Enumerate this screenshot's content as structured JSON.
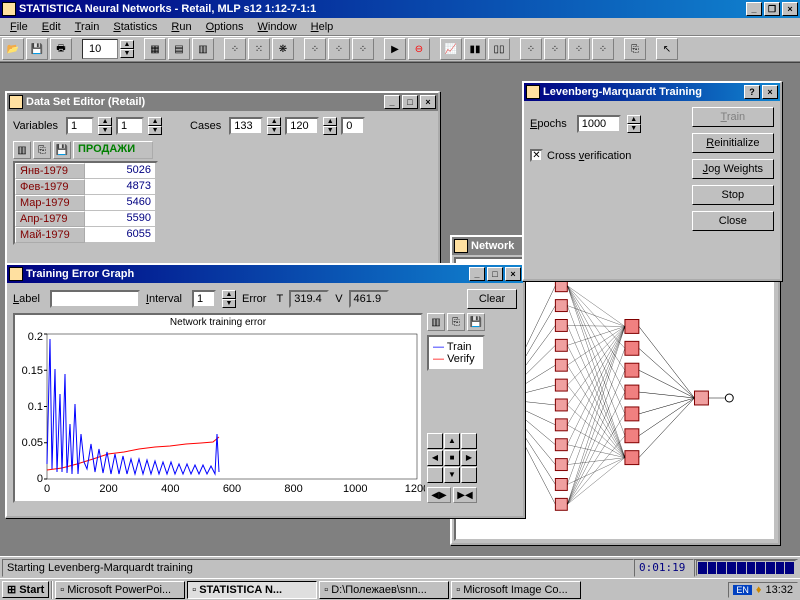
{
  "app": {
    "title": "STATISTICA Neural Networks - Retail, MLP s12 1:12-7-1:1",
    "menus": [
      "File",
      "Edit",
      "Train",
      "Statistics",
      "Run",
      "Options",
      "Window",
      "Help"
    ],
    "spinner_value": "10"
  },
  "dataset_editor": {
    "title": "Data Set Editor (Retail)",
    "variables_label": "Variables",
    "var1": "1",
    "var2": "1",
    "cases_label": "Cases",
    "cases1": "133",
    "cases2": "120",
    "cases3": "0",
    "col_header": "ПРОДАЖИ",
    "rows": [
      {
        "h": "Янв-1979",
        "v": "5026"
      },
      {
        "h": "Фев-1979",
        "v": "4873"
      },
      {
        "h": "Мар-1979",
        "v": "5460"
      },
      {
        "h": "Апр-1979",
        "v": "5590"
      },
      {
        "h": "Май-1979",
        "v": "6055"
      }
    ]
  },
  "training_graph": {
    "title": "Training Error Graph",
    "label_label": "Label",
    "label_value": "",
    "interval_label": "Interval",
    "interval_value": "1",
    "error_label": "Error",
    "error_T": "T",
    "error_Tv": "319.4",
    "error_V": "V",
    "error_Vv": "461.9",
    "clear": "Clear",
    "chart_title": "Network training error",
    "legend": {
      "train": "Train",
      "verify": "Verify"
    }
  },
  "chart_data": {
    "type": "line",
    "title": "Network training error",
    "xlabel": "",
    "ylabel": "",
    "xlim": [
      0,
      1200
    ],
    "ylim": [
      0,
      0.2
    ],
    "xticks": [
      0,
      200,
      400,
      600,
      800,
      1000,
      1200
    ],
    "yticks": [
      0,
      0.05,
      0.1,
      0.15,
      0.2
    ],
    "series": [
      {
        "name": "Train",
        "color": "#0000ff",
        "x_range": [
          0,
          560
        ],
        "values_approx": "spiky decaying oscillation; initial spike ~0.19 at x~10, several spikes 0.10-0.15 before x=100, then oscillating 0.01-0.07 with period ~20, decaying; ends at x~560 with small spike ~0.06"
      },
      {
        "name": "Verify",
        "color": "#ff0000",
        "x": [
          0,
          50,
          100,
          150,
          200,
          250,
          300,
          350,
          400,
          450,
          500,
          540,
          560
        ],
        "y": [
          0.012,
          0.015,
          0.02,
          0.028,
          0.034,
          0.038,
          0.042,
          0.045,
          0.047,
          0.049,
          0.05,
          0.051,
          0.058
        ]
      }
    ]
  },
  "network_win": {
    "title": "Network"
  },
  "lm_training": {
    "title": "Levenberg-Marquardt Training",
    "epochs_label": "Epochs",
    "epochs_value": "1000",
    "cross_verify": "Cross verification",
    "cross_checked": true,
    "buttons": {
      "train": "Train",
      "reinit": "Reinitialize",
      "jog": "Jog Weights",
      "stop": "Stop",
      "close": "Close"
    }
  },
  "statusbar": {
    "msg": "Starting Levenberg-Marquardt training",
    "time": "0:01:19"
  },
  "taskbar": {
    "start": "Start",
    "items": [
      {
        "label": "Microsoft PowerPoi...",
        "pressed": false
      },
      {
        "label": "STATISTICA N...",
        "pressed": true
      },
      {
        "label": "D:\\Полежаев\\snn...",
        "pressed": false
      },
      {
        "label": "Microsoft Image Co...",
        "pressed": false
      }
    ],
    "lang": "EN",
    "clock": "13:32"
  }
}
